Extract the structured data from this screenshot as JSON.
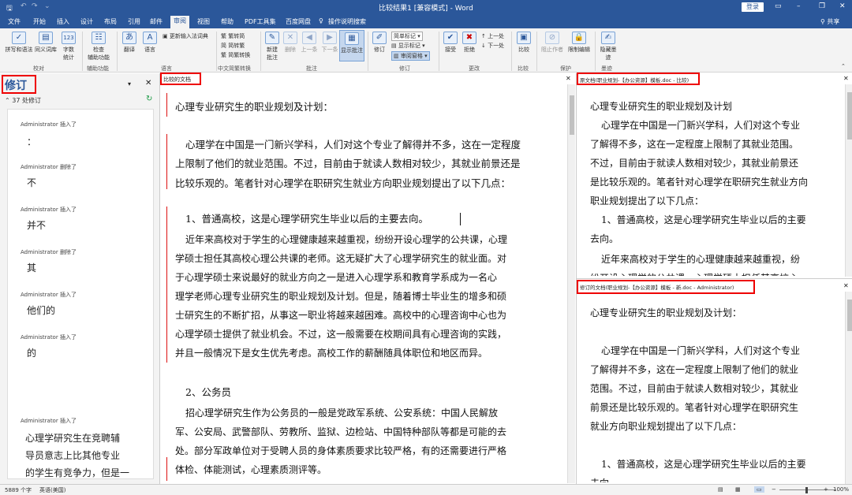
{
  "title": "比较结果1 [兼容模式] - Word",
  "login": "登录",
  "tabs": [
    "文件",
    "开始",
    "插入",
    "设计",
    "布局",
    "引用",
    "邮件",
    "审阅",
    "视图",
    "帮助",
    "PDF工具集",
    "百度网盘"
  ],
  "tell_me": "操作说明搜索",
  "share": "共享",
  "ribbon": {
    "spell": "拼写和语法",
    "thesaurus": "同义词库",
    "wordcount_l1": "字数",
    "wordcount_l2": "统计",
    "check_l1": "检查",
    "check_l2": "辅助功能",
    "translate": "翻译",
    "language": "语言",
    "ime": "更新输入法词典",
    "to_trad": "繁转简",
    "to_simp": "简转繁",
    "convert": "简繁转换",
    "new_comment_l1": "新建",
    "new_comment_l2": "批注",
    "delete": "删除",
    "prev": "上一条",
    "next": "下一条",
    "show_comments": "显示批注",
    "track": "修订",
    "markup_simple": "简单标记",
    "show_markup": "显示标记",
    "review_pane": "审阅窗格",
    "accept": "接受",
    "reject": "拒绝",
    "prev_change": "上一处",
    "next_change": "下一处",
    "compare": "比较",
    "block_authors": "阻止作者",
    "restrict": "限制编辑",
    "hide_ink_l1": "隐藏墨",
    "hide_ink_l2": "迹",
    "groups": {
      "proofing": "校对",
      "accessibility": "辅助功能",
      "language": "语言",
      "chinese": "中文简繁转换",
      "comments": "批注",
      "tracking": "修订",
      "changes": "更改",
      "compare": "比较",
      "protect": "保护",
      "ink": "墨迹"
    }
  },
  "revisions_pane": {
    "title": "修订",
    "count": "37 处修订",
    "items": [
      {
        "author": "Administrator 插入了",
        "text": "："
      },
      {
        "author": "Administrator 删除了",
        "text": "不"
      },
      {
        "author": "Administrator 插入了",
        "text": "并不"
      },
      {
        "author": "Administrator 删除了",
        "text": "其"
      },
      {
        "author": "Administrator 插入了",
        "text": "他们的"
      },
      {
        "author": "Administrator 插入了",
        "text": "的"
      },
      {
        "author": "Administrator 插入了",
        "text": ""
      }
    ],
    "last_text": [
      "心理学研究生在竞聘辅",
      "导员意志上比其他专业",
      "的学生有竞争力，但是一"
    ]
  },
  "compared": {
    "label": "比较的文档",
    "lines": [
      "心理专业研究生的职业规划及计划：",
      "心理学在中国是一门新兴学科，人们对这个专业了解得并不多，这在一定程度",
      "上限制了他们的就业范围。不过，目前由于就读人数相对较少，其就业前景还是",
      "比较乐观的。笔者针对心理学在职研究生就业方向职业规划提出了以下几点：",
      "1、普通高校，这是心理学研究生毕业以后的主要去向。",
      "近年来高校对于学生的心理健康越来越重视，纷纷开设心理学的公共课，心理",
      "学硕士担任其高校心理公共课的老师。这无疑扩大了心理学研究生的就业面。对",
      "于心理学硕士来说最好的就业方向之一是进入心理学系和教育学系成为一名心",
      "理学老师心理专业研究生的职业规划及计划。但是，随着博士毕业生的增多和硕",
      "士研究生的不断扩招，从事这一职业将越来越困难。高校中的心理咨询中心也为",
      "心理学硕士提供了就业机会。不过，这一般需要在校期间具有心理咨询的实践，",
      "并且一般情况下是女生优先考虑。高校工作的薪酬随具体职位和地区而异。",
      "2、公务员",
      "招心理学研究生作为公务员的一般是党政军系统、公安系统：中国人民解放",
      "军、公安局、武警部队、劳教所、监狱、边检站、中国特种部队等都是可能的去",
      "处。部分军政单位对于受聘人员的身体素质要求比较严格，有的还需要进行严格",
      "体检、体能测试，心理素质测评等。"
    ]
  },
  "original": {
    "label": "原文档(职业规划-【办公资源】模板.doc - 比较)",
    "lines": [
      "心理专业研究生的职业规划及计划",
      "心理学在中国是一门新兴学科，人们对这个专业",
      "了解得不多，这在一定程度上限制了其就业范围。",
      "不过，目前由于就读人数相对较少，其就业前景还",
      "是比较乐观的。笔者针对心理学在职研究生就业方向",
      "职业规划提出了以下几点：",
      "1、普通高校，这是心理学研究生毕业以后的主要",
      "去向。",
      "近年来高校对于学生的心理健康越来越重视，纷",
      "纷开设心理学的公共课，心理学硕士担任其高校心"
    ]
  },
  "revised": {
    "label": "修订的文档(职业规划-【办公资源】模板 - 新.doc - Administrator)",
    "lines": [
      "心理专业研究生的职业规划及计划：",
      "心理学在中国是一门新兴学科，人们对这个专业",
      "了解得并不多，这在一定程度上限制了他们的就业",
      "范围。不过，目前由于就读人数相对较少，其就业",
      "前景还是比较乐观的。笔者针对心理学在职研究生",
      "就业方向职业规划提出了以下几点：",
      "1、普通高校，这是心理学研究生毕业以后的主要",
      "去向"
    ]
  },
  "status": {
    "words": "5889 个字",
    "lang": "英语(美国)",
    "zoom": "100%"
  }
}
